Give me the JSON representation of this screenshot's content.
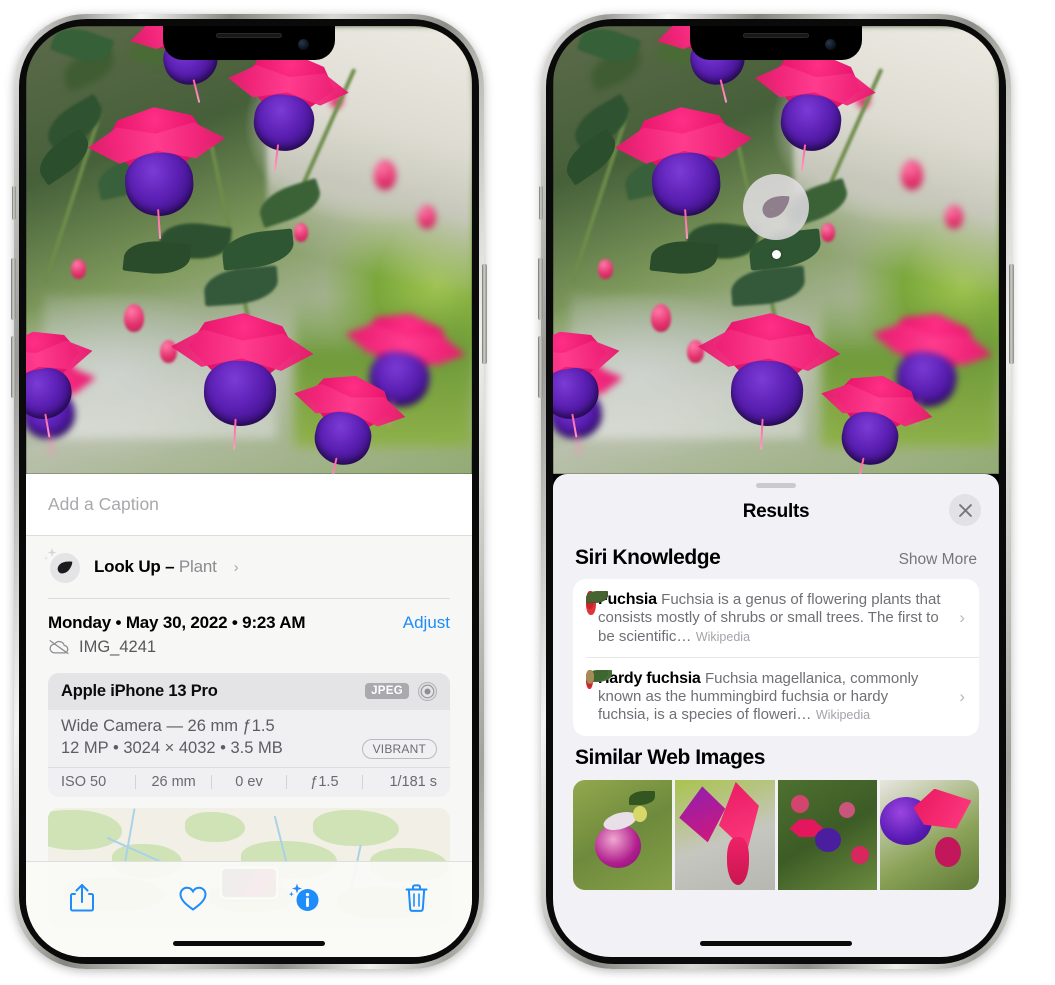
{
  "left_phone": {
    "name": "photo-info-screen",
    "caption": {
      "placeholder": "Add a Caption",
      "value": ""
    },
    "lookup": {
      "icon": "leaf-sparkle-icon",
      "label": "Look Up",
      "separator": "–",
      "kind": "Plant",
      "chevron": "›"
    },
    "date": {
      "text": "Monday • May 30, 2022 • 9:23 AM",
      "adjust_label": "Adjust",
      "cloud_icon": "cloud-slash-icon",
      "file_name": "IMG_4241"
    },
    "camera_card": {
      "model": "Apple iPhone 13 Pro",
      "format_badge": "JPEG",
      "aperture_icon": "aperture-icon",
      "lens": "Wide Camera — 26 mm ƒ1.5",
      "specs": "12 MP • 3024 × 4032 • 3.5 MB",
      "style_badge": "VIBRANT",
      "exif": [
        "ISO 50",
        "26 mm",
        "0 ev",
        "ƒ1.5",
        "1/181 s"
      ]
    },
    "map": {
      "name": "location-map",
      "pin": "photo-thumbnail-pin"
    },
    "toolbar": [
      {
        "name": "share-button",
        "icon": "share-icon"
      },
      {
        "name": "favorite-button",
        "icon": "heart-icon"
      },
      {
        "name": "info-button",
        "icon": "info-sparkle-icon"
      },
      {
        "name": "delete-button",
        "icon": "trash-icon"
      }
    ],
    "accent_color": "#1e8cfb"
  },
  "right_phone": {
    "name": "visual-lookup-results-screen",
    "photo_badge": {
      "icon": "leaf-icon",
      "label": "plant-detected-badge"
    },
    "sheet": {
      "grabber": "sheet-grabber",
      "title": "Results",
      "close_icon": "close-icon"
    },
    "siri_knowledge": {
      "title": "Siri Knowledge",
      "show_more": "Show More",
      "items": [
        {
          "title": "Fuchsia",
          "description": "Fuchsia is a genus of flowering plants that consists mostly of shrubs or small trees. The first to be scientific…",
          "source": "Wikipedia",
          "chevron": "›"
        },
        {
          "title": "Hardy fuchsia",
          "description": "Fuchsia magellanica, commonly known as the hummingbird fuchsia or hardy fuchsia, is a species of floweri…",
          "source": "Wikipedia",
          "chevron": "›"
        }
      ]
    },
    "similar_web_images": {
      "title": "Similar Web Images",
      "tiles": [
        "web-image-1",
        "web-image-2",
        "web-image-3",
        "web-image-4"
      ]
    }
  }
}
